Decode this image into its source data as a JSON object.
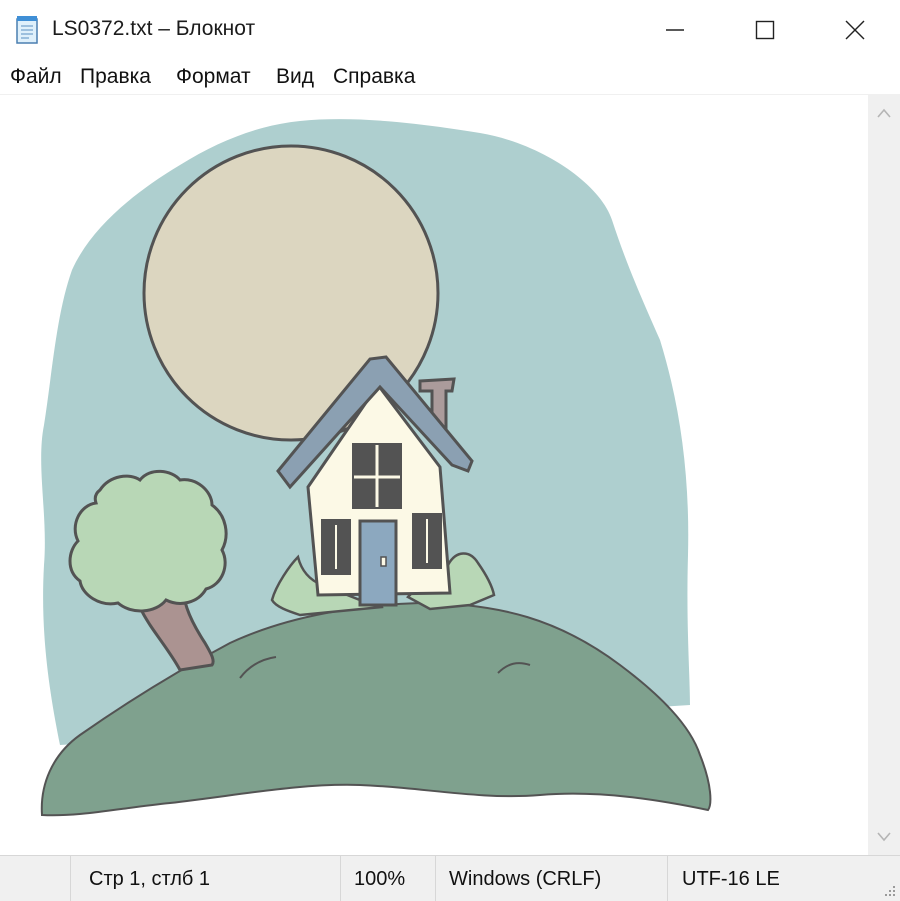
{
  "window": {
    "title": "LS0372.txt – Блокнот",
    "controls": [
      "minimize",
      "maximize",
      "close"
    ]
  },
  "menu": {
    "items": [
      "Файл",
      "Правка",
      "Формат",
      "Вид",
      "Справка"
    ]
  },
  "document": {
    "content_type": "ascii-art-image",
    "subject": "house on a hill under a full moon"
  },
  "statusbar": {
    "position": "Стр 1, стлб 1",
    "zoom": "100%",
    "line_endings": "Windows (CRLF)",
    "encoding": "UTF-16 LE"
  },
  "colors": {
    "sky": "#8fbcbc",
    "moon": "#cfc6a8",
    "hill": "#4d7d62",
    "tree_foliage": "#9cc79a",
    "trunk": "#8a6a66",
    "house_wall": "#fbf7dc",
    "roof": "#5e7c94",
    "door": "#5f87a6",
    "chimney": "#8a7474",
    "outline": "#111111"
  }
}
